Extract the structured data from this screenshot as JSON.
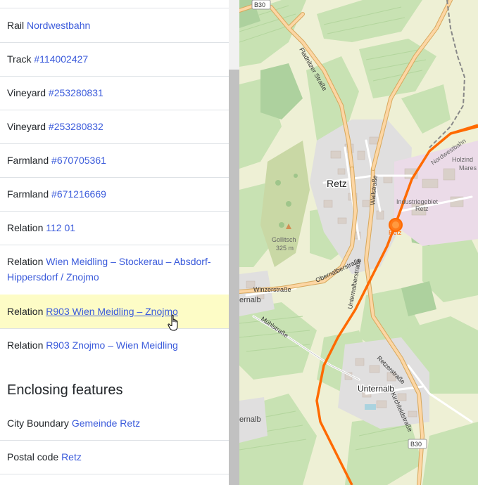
{
  "features": [
    {
      "type": "Rail",
      "link": "Nordwestbahn"
    },
    {
      "type": "Track",
      "link": "#114002427"
    },
    {
      "type": "Vineyard",
      "link": "#253280831"
    },
    {
      "type": "Vineyard",
      "link": "#253280832"
    },
    {
      "type": "Farmland",
      "link": "#670705361"
    },
    {
      "type": "Farmland",
      "link": "#671216669"
    },
    {
      "type": "Relation",
      "link": "112 01"
    },
    {
      "type": "Relation",
      "link": "Wien Meidling – Stockerau – Absdorf-Hippersdorf / Znojmo"
    },
    {
      "type": "Relation",
      "link": "R903 Wien Meidling – Znojmo"
    },
    {
      "type": "Relation",
      "link": "R903 Znojmo – Wien Meidling"
    }
  ],
  "enclosing": {
    "heading": "Enclosing features",
    "items": [
      {
        "type": "City Boundary",
        "link": "Gemeinde Retz"
      },
      {
        "type": "Postal code",
        "link": "Retz"
      }
    ]
  },
  "map": {
    "labels": {
      "road_b30_top": "B30",
      "road_b30_bottom": "B30",
      "fladnitzer": "Fladnitzer Straße",
      "nordwestbahn": "Nordwestbahn",
      "holzindustrie": "Holzind",
      "mares": "Mares",
      "retz": "Retz",
      "wallstrasse": "Wallstraße",
      "industriegebiet": "Industriegebiet",
      "industriegebiet_retz": "Retz",
      "station": "Retz",
      "gollitsch": "Gollitsch",
      "gollitsch_ele": "325 m",
      "obernalberstrasse": "Obernalberstraße",
      "unternalberstrasse": "Unternalberstraße",
      "winzerstrasse": "Winzerstraße",
      "unternalb_left": "ernalb",
      "muehlstrasse": "Mühlstraße",
      "retzerstrasse": "Retzerstraße",
      "unternalb": "Unternalb",
      "kirchfeldstrasse": "Kirchfeldstraße",
      "ernalb_bottom": "ernalb"
    },
    "colors": {
      "background": "#f2efe9",
      "vineyard": "#aedfa3",
      "farmland": "#eef0d5",
      "forest": "#add19e",
      "residential": "#e0dfdf",
      "building": "#d9d0c9",
      "road_primary": "#fcd6a4",
      "road_outline": "#d7a85d",
      "railway_highlight": "#ff6a00",
      "industrial": "#ebdbe8"
    }
  }
}
